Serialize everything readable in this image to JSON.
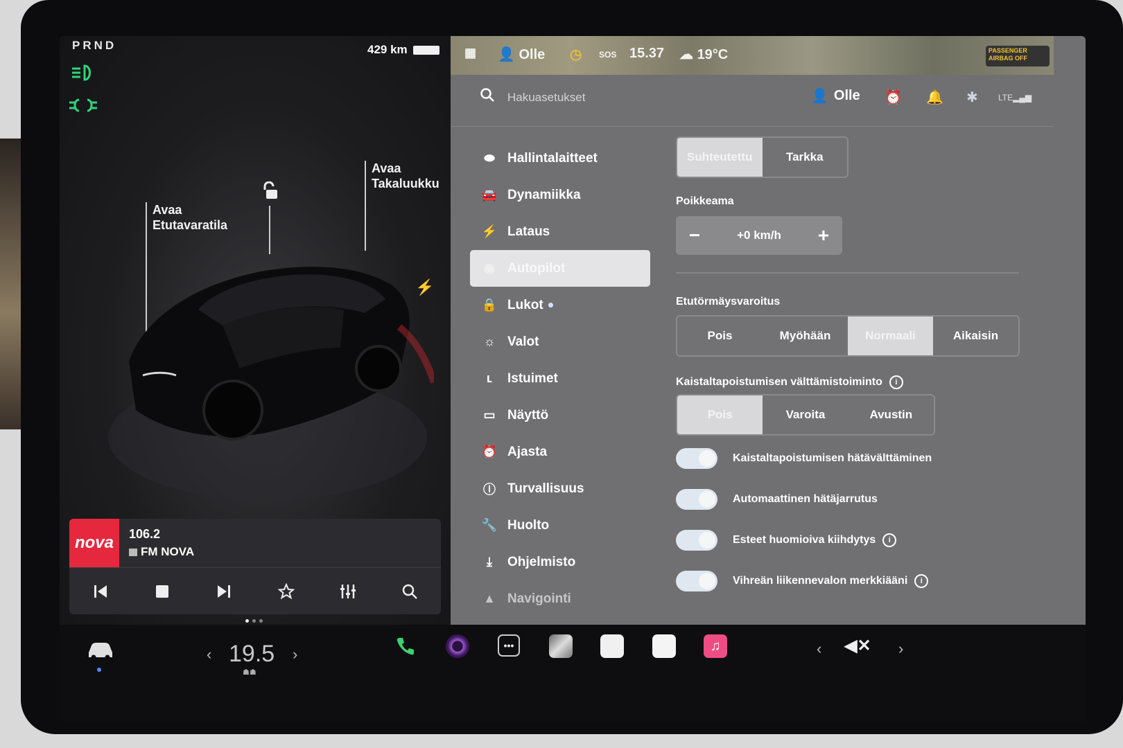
{
  "status": {
    "gear": "PRND",
    "range": "429 km"
  },
  "car": {
    "frunk_label_1": "Avaa",
    "frunk_label_2": "Etutavaratila",
    "trunk_label_1": "Avaa",
    "trunk_label_2": "Takaluukku"
  },
  "media": {
    "logo": "nova",
    "frequency": "106.2",
    "station": "FM NOVA"
  },
  "map_strip": {
    "user": "Olle",
    "time": "15.37",
    "temperature": "19°C",
    "airbag_line1": "PASSENGER",
    "airbag_line2": "AIRBAG OFF"
  },
  "search": {
    "placeholder": "Hakuasetukset"
  },
  "header": {
    "user": "Olle"
  },
  "menu": [
    {
      "label": "Hallintalaitteet",
      "icon": "toggle-icon"
    },
    {
      "label": "Dynamiikka",
      "icon": "car-icon"
    },
    {
      "label": "Lataus",
      "icon": "bolt-icon"
    },
    {
      "label": "Autopilot",
      "icon": "steering-wheel-icon",
      "selected": true
    },
    {
      "label": "Lukot",
      "icon": "lock-icon"
    },
    {
      "label": "Valot",
      "icon": "sun-icon"
    },
    {
      "label": "Istuimet",
      "icon": "seat-icon"
    },
    {
      "label": "Näyttö",
      "icon": "display-icon"
    },
    {
      "label": "Ajasta",
      "icon": "alarm-icon"
    },
    {
      "label": "Turvallisuus",
      "icon": "warning-icon"
    },
    {
      "label": "Huolto",
      "icon": "wrench-icon"
    },
    {
      "label": "Ohjelmisto",
      "icon": "download-icon"
    },
    {
      "label": "Navigointi",
      "icon": "navigation-icon"
    }
  ],
  "autopilot": {
    "speed_mode": {
      "options": [
        "Suhteutettu",
        "Tarkka"
      ],
      "selected": "Suhteutettu"
    },
    "offset_label": "Poikkeama",
    "offset_value": "+0 km/h",
    "fcw_label": "Etutörmäysvaroitus",
    "fcw": {
      "options": [
        "Pois",
        "Myöhään",
        "Normaali",
        "Aikaisin"
      ],
      "selected": "Normaali"
    },
    "lda_label": "Kaistaltapoistumisen välttämistoiminto",
    "lda": {
      "options": [
        "Pois",
        "Varoita",
        "Avustin"
      ],
      "selected": "Pois"
    },
    "toggles": [
      {
        "label": "Kaistaltapoistumisen hätävälttäminen",
        "on": true,
        "info": false
      },
      {
        "label": "Automaattinen hätäjarrutus",
        "on": true,
        "info": false
      },
      {
        "label": "Esteet huomioiva kiihdytys",
        "on": true,
        "info": true
      },
      {
        "label": "Vihreän liikennevalon merkkiääni",
        "on": true,
        "info": true
      }
    ]
  },
  "taskbar": {
    "temperature": "19.5"
  },
  "colors": {
    "accent_green": "#2fd57a",
    "selected_bg": "#e4e4e6",
    "panel_bg": "#707073",
    "nova_red": "#e5283d"
  }
}
